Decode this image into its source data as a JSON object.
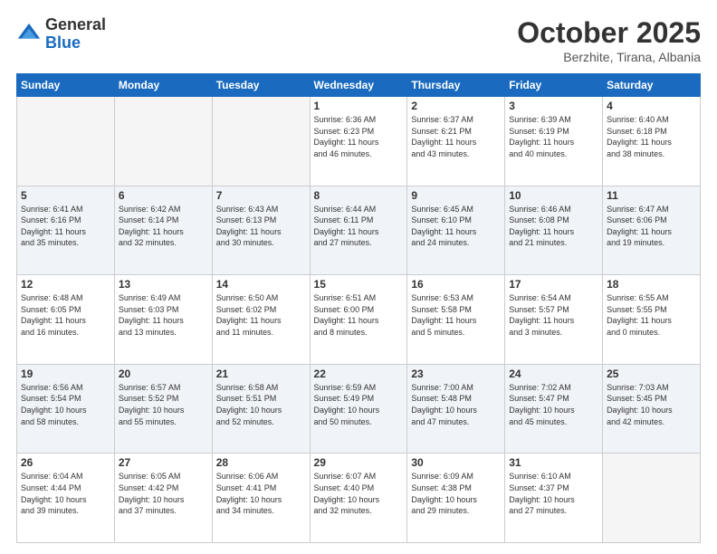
{
  "header": {
    "logo_general": "General",
    "logo_blue": "Blue",
    "title": "October 2025",
    "location": "Berzhite, Tirana, Albania"
  },
  "days_of_week": [
    "Sunday",
    "Monday",
    "Tuesday",
    "Wednesday",
    "Thursday",
    "Friday",
    "Saturday"
  ],
  "weeks": [
    {
      "shaded": false,
      "days": [
        {
          "num": "",
          "info": ""
        },
        {
          "num": "",
          "info": ""
        },
        {
          "num": "",
          "info": ""
        },
        {
          "num": "1",
          "info": "Sunrise: 6:36 AM\nSunset: 6:23 PM\nDaylight: 11 hours\nand 46 minutes."
        },
        {
          "num": "2",
          "info": "Sunrise: 6:37 AM\nSunset: 6:21 PM\nDaylight: 11 hours\nand 43 minutes."
        },
        {
          "num": "3",
          "info": "Sunrise: 6:39 AM\nSunset: 6:19 PM\nDaylight: 11 hours\nand 40 minutes."
        },
        {
          "num": "4",
          "info": "Sunrise: 6:40 AM\nSunset: 6:18 PM\nDaylight: 11 hours\nand 38 minutes."
        }
      ]
    },
    {
      "shaded": true,
      "days": [
        {
          "num": "5",
          "info": "Sunrise: 6:41 AM\nSunset: 6:16 PM\nDaylight: 11 hours\nand 35 minutes."
        },
        {
          "num": "6",
          "info": "Sunrise: 6:42 AM\nSunset: 6:14 PM\nDaylight: 11 hours\nand 32 minutes."
        },
        {
          "num": "7",
          "info": "Sunrise: 6:43 AM\nSunset: 6:13 PM\nDaylight: 11 hours\nand 30 minutes."
        },
        {
          "num": "8",
          "info": "Sunrise: 6:44 AM\nSunset: 6:11 PM\nDaylight: 11 hours\nand 27 minutes."
        },
        {
          "num": "9",
          "info": "Sunrise: 6:45 AM\nSunset: 6:10 PM\nDaylight: 11 hours\nand 24 minutes."
        },
        {
          "num": "10",
          "info": "Sunrise: 6:46 AM\nSunset: 6:08 PM\nDaylight: 11 hours\nand 21 minutes."
        },
        {
          "num": "11",
          "info": "Sunrise: 6:47 AM\nSunset: 6:06 PM\nDaylight: 11 hours\nand 19 minutes."
        }
      ]
    },
    {
      "shaded": false,
      "days": [
        {
          "num": "12",
          "info": "Sunrise: 6:48 AM\nSunset: 6:05 PM\nDaylight: 11 hours\nand 16 minutes."
        },
        {
          "num": "13",
          "info": "Sunrise: 6:49 AM\nSunset: 6:03 PM\nDaylight: 11 hours\nand 13 minutes."
        },
        {
          "num": "14",
          "info": "Sunrise: 6:50 AM\nSunset: 6:02 PM\nDaylight: 11 hours\nand 11 minutes."
        },
        {
          "num": "15",
          "info": "Sunrise: 6:51 AM\nSunset: 6:00 PM\nDaylight: 11 hours\nand 8 minutes."
        },
        {
          "num": "16",
          "info": "Sunrise: 6:53 AM\nSunset: 5:58 PM\nDaylight: 11 hours\nand 5 minutes."
        },
        {
          "num": "17",
          "info": "Sunrise: 6:54 AM\nSunset: 5:57 PM\nDaylight: 11 hours\nand 3 minutes."
        },
        {
          "num": "18",
          "info": "Sunrise: 6:55 AM\nSunset: 5:55 PM\nDaylight: 11 hours\nand 0 minutes."
        }
      ]
    },
    {
      "shaded": true,
      "days": [
        {
          "num": "19",
          "info": "Sunrise: 6:56 AM\nSunset: 5:54 PM\nDaylight: 10 hours\nand 58 minutes."
        },
        {
          "num": "20",
          "info": "Sunrise: 6:57 AM\nSunset: 5:52 PM\nDaylight: 10 hours\nand 55 minutes."
        },
        {
          "num": "21",
          "info": "Sunrise: 6:58 AM\nSunset: 5:51 PM\nDaylight: 10 hours\nand 52 minutes."
        },
        {
          "num": "22",
          "info": "Sunrise: 6:59 AM\nSunset: 5:49 PM\nDaylight: 10 hours\nand 50 minutes."
        },
        {
          "num": "23",
          "info": "Sunrise: 7:00 AM\nSunset: 5:48 PM\nDaylight: 10 hours\nand 47 minutes."
        },
        {
          "num": "24",
          "info": "Sunrise: 7:02 AM\nSunset: 5:47 PM\nDaylight: 10 hours\nand 45 minutes."
        },
        {
          "num": "25",
          "info": "Sunrise: 7:03 AM\nSunset: 5:45 PM\nDaylight: 10 hours\nand 42 minutes."
        }
      ]
    },
    {
      "shaded": false,
      "days": [
        {
          "num": "26",
          "info": "Sunrise: 6:04 AM\nSunset: 4:44 PM\nDaylight: 10 hours\nand 39 minutes."
        },
        {
          "num": "27",
          "info": "Sunrise: 6:05 AM\nSunset: 4:42 PM\nDaylight: 10 hours\nand 37 minutes."
        },
        {
          "num": "28",
          "info": "Sunrise: 6:06 AM\nSunset: 4:41 PM\nDaylight: 10 hours\nand 34 minutes."
        },
        {
          "num": "29",
          "info": "Sunrise: 6:07 AM\nSunset: 4:40 PM\nDaylight: 10 hours\nand 32 minutes."
        },
        {
          "num": "30",
          "info": "Sunrise: 6:09 AM\nSunset: 4:38 PM\nDaylight: 10 hours\nand 29 minutes."
        },
        {
          "num": "31",
          "info": "Sunrise: 6:10 AM\nSunset: 4:37 PM\nDaylight: 10 hours\nand 27 minutes."
        },
        {
          "num": "",
          "info": ""
        }
      ]
    }
  ]
}
